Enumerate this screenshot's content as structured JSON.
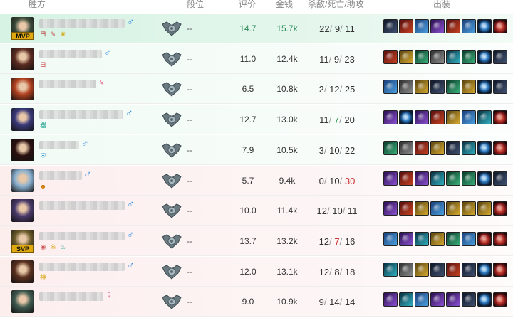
{
  "header": {
    "champion": "胜方",
    "rank": "段位",
    "score": "评价",
    "gold": "金钱",
    "kda": "杀敌/死亡/助攻",
    "items": "出装"
  },
  "players": [
    {
      "avatar_color": "#3a4a3a",
      "badge_top": "MVP",
      "gender": "male",
      "badges": [
        "ヨ",
        "✎",
        "♛"
      ],
      "rank": "--",
      "score": "14.7",
      "gold": "15.7k",
      "k": "22",
      "d": "9",
      "a": "11",
      "items": [
        "it-dark",
        "it-red",
        "it-blue",
        "it-purple",
        "it-red",
        "it-blue",
        "it-orb",
        "it-brain"
      ]
    },
    {
      "avatar_color": "#5a2a20",
      "badge_top": "",
      "gender": "male",
      "badges": [
        "ヨ"
      ],
      "rank": "--",
      "score": "11.0",
      "gold": "12.4k",
      "k": "11",
      "d": "9",
      "a": "23",
      "items": [
        "it-red",
        "it-gold",
        "it-green",
        "it-gray",
        "it-teal",
        "it-green",
        "it-orb",
        "it-dark"
      ]
    },
    {
      "avatar_color": "#b04020",
      "badge_top": "",
      "gender": "female",
      "badges": [],
      "rank": "--",
      "score": "6.5",
      "gold": "10.8k",
      "k": "2",
      "d": "12",
      "a": "25",
      "items": [
        "it-blue",
        "it-gray",
        "it-gold",
        "it-dark",
        "it-green",
        "it-gold",
        "it-orb",
        "it-dark"
      ]
    },
    {
      "avatar_color": "#3a3a7a",
      "badge_top": "",
      "gender": "male",
      "badges": [
        "器"
      ],
      "rank": "--",
      "score": "12.7",
      "gold": "13.0k",
      "k": "11",
      "d": "7",
      "a": "20",
      "items": [
        "it-purple",
        "it-orb",
        "it-purple",
        "it-red",
        "it-gold",
        "it-blue",
        "it-teal",
        "it-brain"
      ]
    },
    {
      "avatar_color": "#2a1010",
      "badge_top": "",
      "gender": "male",
      "badges": [
        "⛨"
      ],
      "rank": "--",
      "score": "7.9",
      "gold": "10.5k",
      "k": "3",
      "d": "10",
      "a": "22",
      "items": [
        "it-green",
        "it-gray",
        "it-red",
        "it-gold",
        "it-dark",
        "it-teal",
        "it-orb",
        "it-brain"
      ]
    },
    {
      "avatar_color": "#8ab0d0",
      "badge_top": "",
      "gender": "male",
      "badges": [
        "☻"
      ],
      "rank": "--",
      "score": "5.7",
      "gold": "9.4k",
      "k": "0",
      "d": "10",
      "a": "30",
      "items": [
        "it-purple",
        "it-red",
        "it-purple",
        "it-teal",
        "it-green",
        "it-green",
        "it-orb",
        "it-dark"
      ]
    },
    {
      "avatar_color": "#4a3a6a",
      "badge_top": "",
      "gender": "male",
      "badges": [],
      "rank": "--",
      "score": "10.0",
      "gold": "11.4k",
      "k": "12",
      "d": "10",
      "a": "11",
      "items": [
        "it-purple",
        "it-red",
        "it-gold",
        "it-blue",
        "it-gold",
        "it-gold",
        "it-gold",
        "it-brain"
      ]
    },
    {
      "avatar_color": "#6a5a2a",
      "badge_top": "SVP",
      "gender": "male",
      "badges": [
        "◉",
        "☠",
        "♨"
      ],
      "rank": "--",
      "score": "13.7",
      "gold": "13.2k",
      "k": "12",
      "d": "7",
      "a": "16",
      "items": [
        "it-blue",
        "it-purple",
        "it-teal",
        "it-gold",
        "it-green",
        "it-blue",
        "it-brain",
        "it-brain"
      ]
    },
    {
      "avatar_color": "#5a3020",
      "badge_top": "",
      "gender": "male",
      "badges": [
        "神"
      ],
      "rank": "--",
      "score": "12.0",
      "gold": "13.1k",
      "k": "12",
      "d": "8",
      "a": "18",
      "items": [
        "it-teal",
        "it-gray",
        "it-gold",
        "it-dark",
        "it-red",
        "it-dark",
        "it-orb",
        "it-brain"
      ]
    },
    {
      "avatar_color": "#405a50",
      "badge_top": "",
      "gender": "female",
      "badges": [],
      "rank": "--",
      "score": "9.0",
      "gold": "10.9k",
      "k": "9",
      "d": "14",
      "a": "14",
      "items": [
        "it-purple",
        "it-teal",
        "it-blue",
        "it-purple",
        "it-purple",
        "it-dark",
        "it-orb",
        "it-brain"
      ]
    }
  ]
}
